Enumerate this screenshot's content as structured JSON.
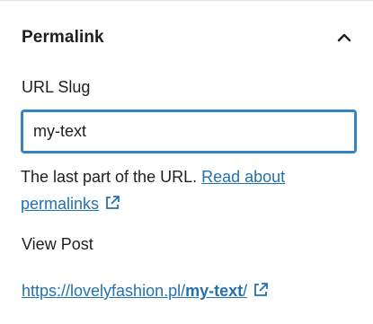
{
  "panel": {
    "title": "Permalink",
    "collapse_icon": "chevron-up-icon"
  },
  "slug_field": {
    "label": "URL Slug",
    "value": "my-text"
  },
  "help": {
    "text": "The last part of the URL. ",
    "link_text_1": "Read about",
    "link_text_2": "permalinks",
    "link_icon": "external-link-icon"
  },
  "view_post": {
    "label": "View Post"
  },
  "url": {
    "base": "https://lovelyfashion.pl/",
    "slug": "my-text",
    "trailing": "/",
    "link_icon": "external-link-icon"
  },
  "colors": {
    "accent": "#3582c4",
    "link": "#2271b1",
    "text": "#1e1e1e",
    "divider": "#e0e0e0"
  }
}
